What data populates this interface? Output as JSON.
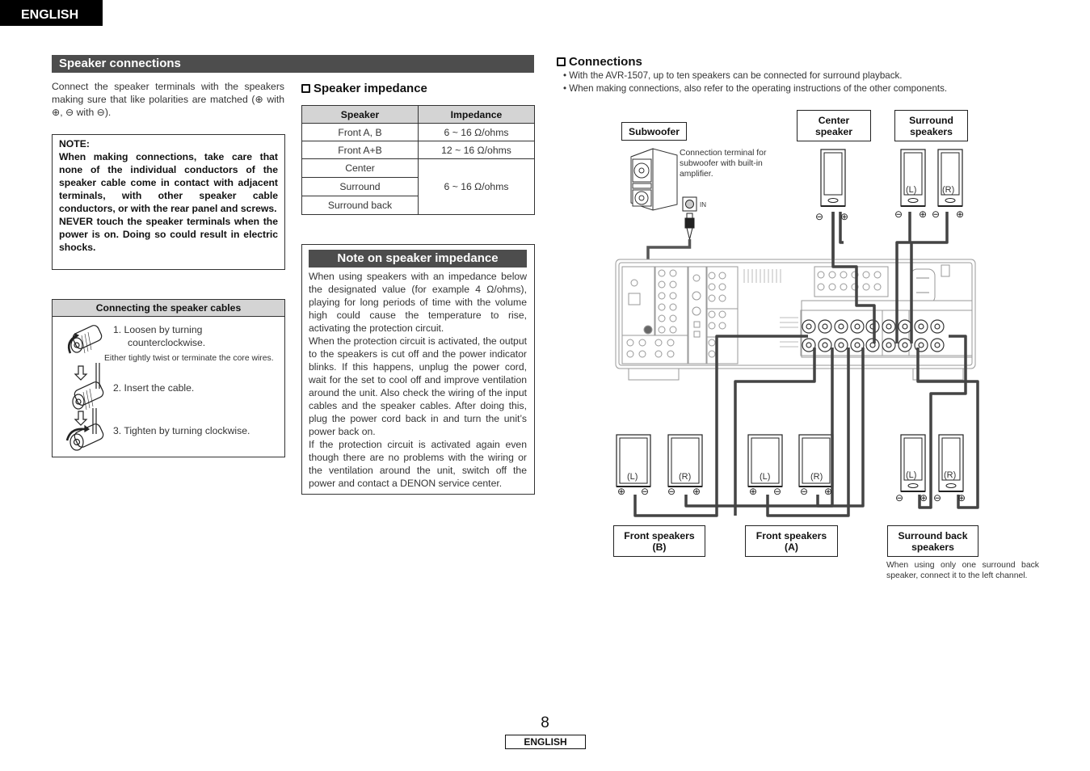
{
  "header": {
    "language_tab": "ENGLISH"
  },
  "speaker_connections": {
    "title": "Speaker connections",
    "intro": "Connect the speaker terminals with the speakers making sure that like polarities are matched (⊕ with ⊕, ⊖ with ⊖).",
    "note": {
      "label": "NOTE:",
      "line1": "When making connections, take care that none of the individual conductors of the speaker cable come in contact with adjacent terminals, with other speaker cable conductors, or with the rear panel and screws.",
      "line2": "NEVER touch the speaker terminals when the power is on. Doing so could result in electric shocks."
    },
    "cables": {
      "title": "Connecting the speaker cables",
      "step1": "1.  Loosen by turning",
      "step1b": "counterclockwise.",
      "twist_note": "Either tightly twist or terminate the core wires.",
      "step2": "2.  Insert the cable.",
      "step3": "3.  Tighten by turning clockwise."
    }
  },
  "speaker_impedance": {
    "title": "Speaker impedance",
    "columns": [
      "Speaker",
      "Impedance"
    ],
    "rows": [
      {
        "speaker": "Front A, B",
        "impedance": "6 ~ 16 Ω/ohms"
      },
      {
        "speaker": "Front A+B",
        "impedance": "12 ~ 16 Ω/ohms"
      },
      {
        "speaker": "Center",
        "impedance": "6 ~ 16 Ω/ohms"
      },
      {
        "speaker": "Surround",
        "impedance": ""
      },
      {
        "speaker": "Surround back",
        "impedance": ""
      }
    ]
  },
  "impedance_note": {
    "title": "Note on speaker impedance",
    "p1": "When using speakers with an impedance below the designated value (for example 4 Ω/ohms), playing for long periods of time with the volume high could cause the temperature to rise, activating the protection circuit.",
    "p2": "When the protection circuit is activated, the output to the speakers is cut off and the power indicator blinks. If this happens, unplug the power cord, wait for the set to cool off and improve ventilation around the unit. Also check the wiring of the input cables and the speaker cables. After doing this, plug the power cord back in and turn the unit’s power back on.",
    "p3": "If the protection circuit is activated again even though there are no problems with the wiring or the ventilation around the unit, switch off the power and contact a DENON service center."
  },
  "connections": {
    "title": "Connections",
    "bullets": [
      "• With the AVR-1507, up to ten speakers can be connected for surround playback.",
      "• When making connections, also refer to the operating instructions of the other components."
    ],
    "diagram": {
      "subwoofer_label": "Subwoofer",
      "subwoofer_caption": "Connection terminal for subwoofer with built-in amplifier.",
      "subwoofer_input": "IN",
      "center_label_1": "Center",
      "center_label_2": "speaker",
      "surround_label_1": "Surround",
      "surround_label_2": "speakers",
      "front_b_label_1": "Front speakers",
      "front_b_label_2": "(B)",
      "front_a_label_1": "Front speakers",
      "front_a_label_2": "(A)",
      "surround_back_label_1": "Surround back",
      "surround_back_label_2": "speakers",
      "surround_back_caption": "When using only one surround back speaker, connect it to the left channel.",
      "left": "(L)",
      "right": "(R)",
      "plus": "⊕",
      "minus": "⊖"
    }
  },
  "footer": {
    "page_number": "8",
    "language": "ENGLISH"
  }
}
